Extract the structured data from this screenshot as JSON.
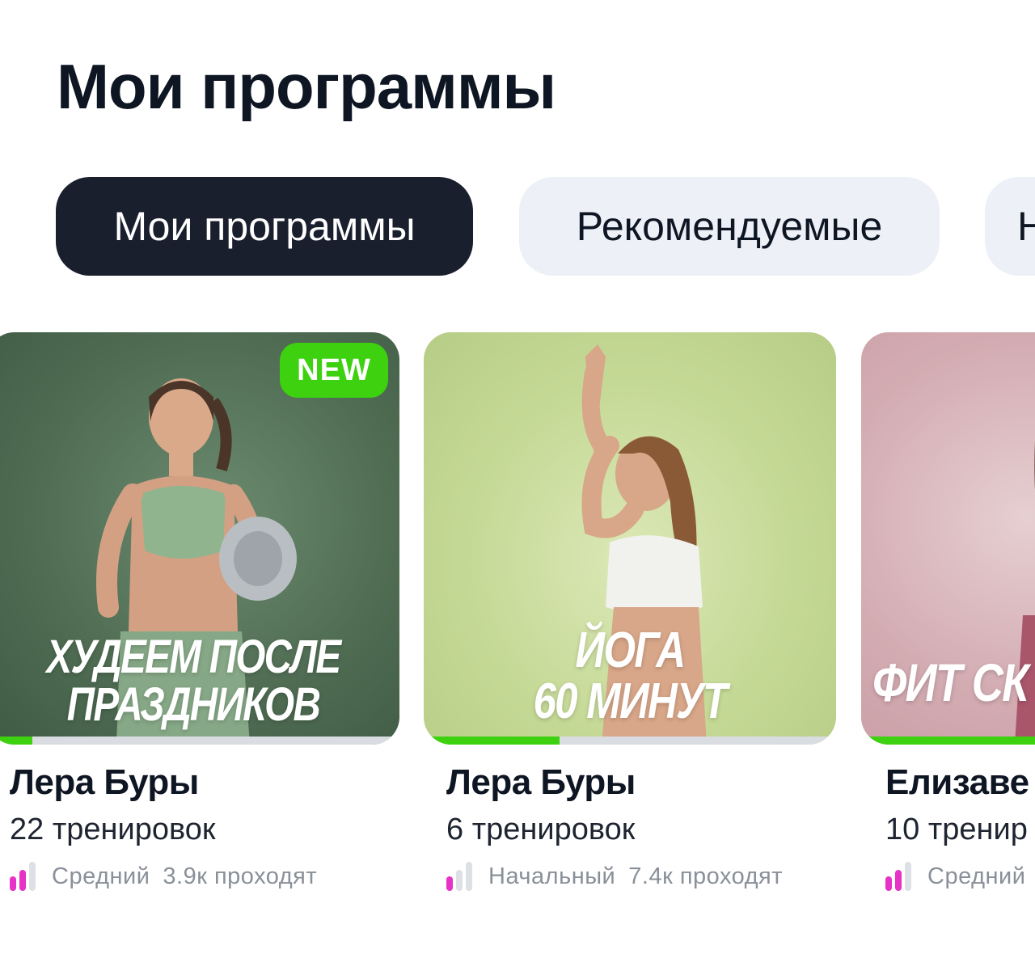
{
  "header": {
    "title": "Мои программы"
  },
  "tabs": [
    {
      "label": "Мои программы",
      "active": true
    },
    {
      "label": "Рекомендуемые",
      "active": false
    },
    {
      "label": "Н",
      "active": false
    }
  ],
  "colors": {
    "accent_green": "#3dd10f",
    "level_pink": "#e632c6",
    "tab_active_bg": "#1a1f2e",
    "tab_inactive_bg": "#edf1f7"
  },
  "cards": [
    {
      "badge": "NEW",
      "cover_title_line1": "ХУДЕЕМ ПОСЛЕ",
      "cover_title_line2": "ПРАЗДНИКОВ",
      "progress": 0.11,
      "author": "Лера Буры",
      "workouts": "22 тренировок",
      "level": "Средний",
      "level_bars": 2,
      "participants": "3.9к проходят"
    },
    {
      "badge": "",
      "cover_title_line1": "ЙОГА",
      "cover_title_line2": "60 МИНУТ",
      "progress": 0.33,
      "author": "Лера Буры",
      "workouts": "6 тренировок",
      "level": "Начальный",
      "level_bars": 1,
      "participants": "7.4к проходят"
    },
    {
      "badge": "",
      "cover_title_line1": "ФИТ СК",
      "cover_title_line2": "",
      "progress": 1.0,
      "author": "Елизаве",
      "workouts": "10 тренир",
      "level": "Средний",
      "level_bars": 2,
      "participants": ""
    }
  ]
}
